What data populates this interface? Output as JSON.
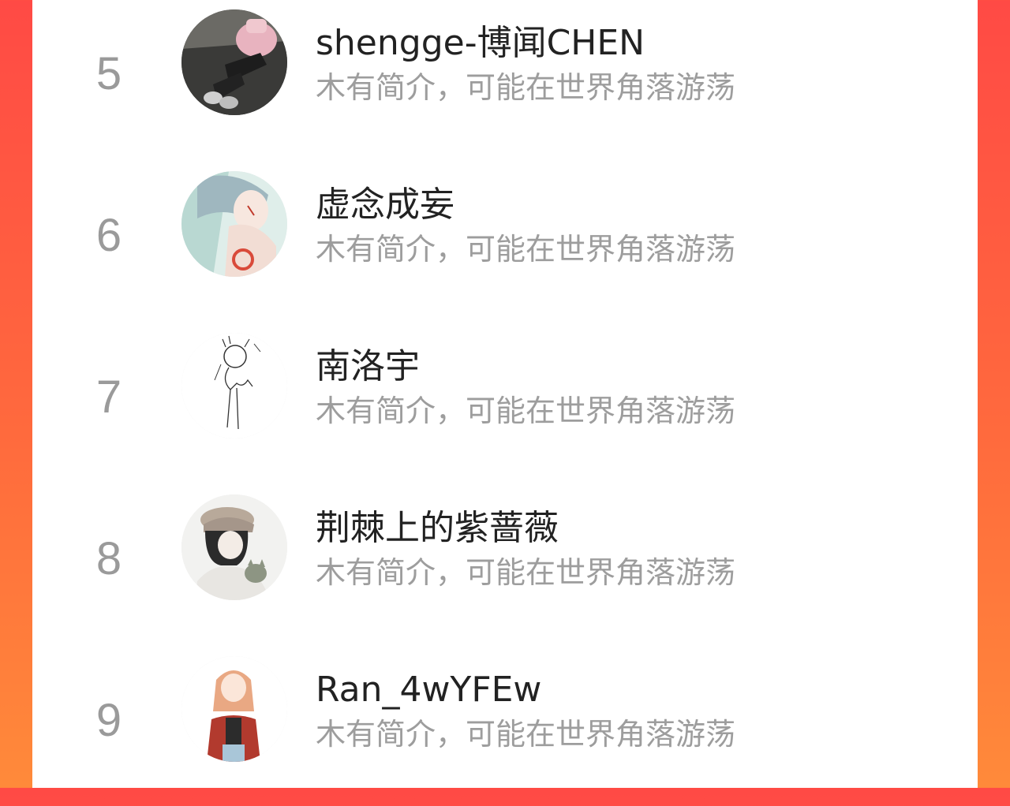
{
  "users": [
    {
      "rank": "5",
      "name": "shengge-博闻CHEN",
      "bio": "木有简介，可能在世界角落游荡",
      "avatar_icon": "user-avatar-photo"
    },
    {
      "rank": "6",
      "name": "虚念成妄",
      "bio": "木有简介，可能在世界角落游荡",
      "avatar_icon": "user-avatar-illustration"
    },
    {
      "rank": "7",
      "name": "南洛宇",
      "bio": "木有简介，可能在世界角落游荡",
      "avatar_icon": "user-avatar-sketch"
    },
    {
      "rank": "8",
      "name": "荆棘上的紫蔷薇",
      "bio": "木有简介，可能在世界角落游荡",
      "avatar_icon": "user-avatar-illustration"
    },
    {
      "rank": "9",
      "name": "Ran_4wYFEw",
      "bio": "木有简介，可能在世界角落游荡",
      "avatar_icon": "user-avatar-illustration"
    }
  ],
  "colors": {
    "background_gradient_top": "#ff4a45",
    "background_gradient_bottom": "#ff8a3a",
    "rank_text": "#9a9a9a",
    "name_text": "#222222",
    "bio_text": "#9d9d9d"
  }
}
